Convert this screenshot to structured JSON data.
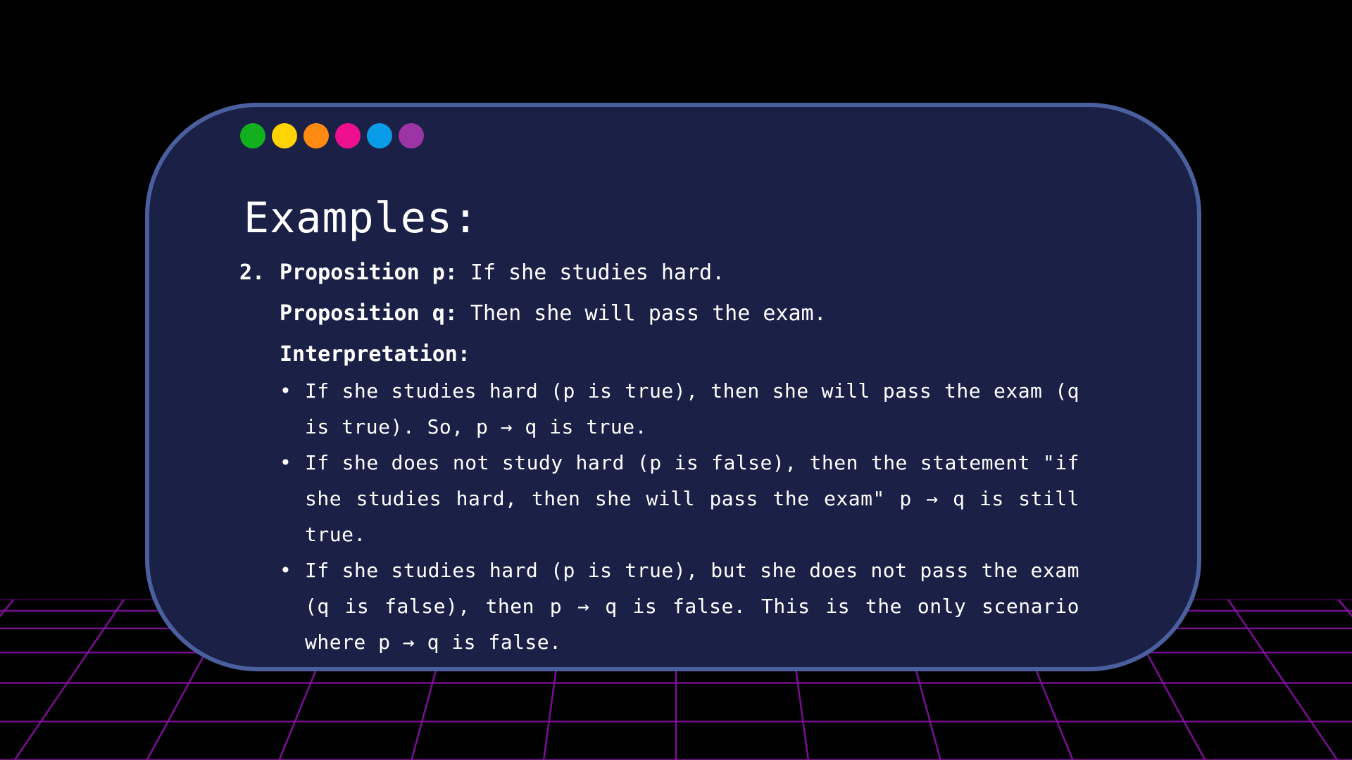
{
  "colors": {
    "background": "#000000",
    "card_background": "#1b2047",
    "card_border": "#4a5f9e",
    "grid_line": "#8a0fa6",
    "text": "#ffffff"
  },
  "window_dots": [
    {
      "name": "green",
      "color": "#12b01e"
    },
    {
      "name": "yellow",
      "color": "#ffd400"
    },
    {
      "name": "orange",
      "color": "#ff8a12"
    },
    {
      "name": "pink",
      "color": "#ee0f8f"
    },
    {
      "name": "blue",
      "color": "#0a9be6"
    },
    {
      "name": "purple",
      "color": "#9b35a6"
    }
  ],
  "slide": {
    "heading": "Examples:",
    "item_number": "2.",
    "prop_p_label": "Proposition p:",
    "prop_p_text": " If she studies hard.",
    "prop_q_label": "Proposition q:",
    "prop_q_text": " Then she will pass the exam.",
    "interpretation_label": "Interpretation:",
    "bullet_glyph": "•",
    "bullets": [
      "If she studies hard (p is true), then she will pass the exam (q is true). So, p → q is true.",
      "If she does not study hard (p is false), then the statement \"if she studies hard, then she will pass the exam\" p → q is still true.",
      "If she studies hard (p is true), but she does not pass the exam (q is false), then p → q is false. This is the only scenario where p → q is false."
    ]
  }
}
